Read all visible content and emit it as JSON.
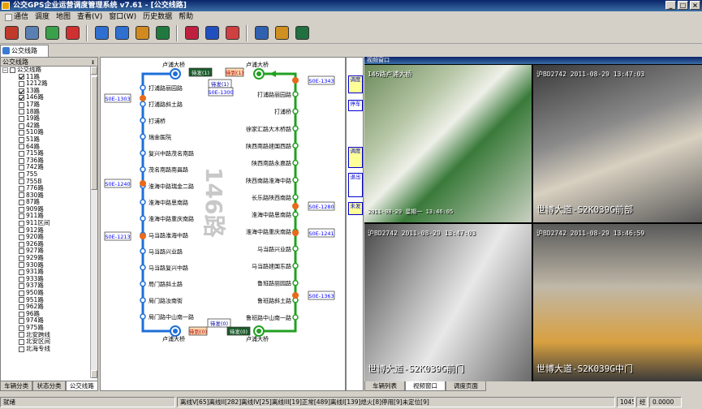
{
  "window": {
    "title": "公交GPS企业运营调度管理系统 v7.61 - [公交线路]"
  },
  "menu": [
    "通信",
    "调度",
    "地图",
    "查看(V)",
    "窗口(W)",
    "历史数据",
    "帮助"
  ],
  "toolbar_icons": [
    "people-icon",
    "document-icon",
    "refresh-icon",
    "delete-icon",
    "zoom-in-icon",
    "zoom-out-icon",
    "globe-icon",
    "grid-icon",
    "book-icon",
    "edit-icon",
    "card-icon",
    "calculator-icon",
    "gift-icon",
    "monitor-icon"
  ],
  "doc_tab": "公交线路",
  "left_panel": {
    "title": "公交线路",
    "root": "公交线路",
    "routes": [
      {
        "name": "11路",
        "checked": true
      },
      {
        "name": "1212路",
        "checked": false
      },
      {
        "name": "13路",
        "checked": true
      },
      {
        "name": "146路",
        "checked": true
      },
      {
        "name": "17路",
        "checked": false
      },
      {
        "name": "18路",
        "checked": false
      },
      {
        "name": "19路",
        "checked": false
      },
      {
        "name": "42路",
        "checked": false
      },
      {
        "name": "510路",
        "checked": false
      },
      {
        "name": "51路",
        "checked": false
      },
      {
        "name": "64路",
        "checked": false
      },
      {
        "name": "715路",
        "checked": false
      },
      {
        "name": "736路",
        "checked": false
      },
      {
        "name": "742路",
        "checked": false
      },
      {
        "name": "755",
        "checked": false
      },
      {
        "name": "755B",
        "checked": false
      },
      {
        "name": "776路",
        "checked": false
      },
      {
        "name": "830路",
        "checked": false
      },
      {
        "name": "87路",
        "checked": false
      },
      {
        "name": "909路",
        "checked": false
      },
      {
        "name": "911路",
        "checked": false
      },
      {
        "name": "911区间",
        "checked": false
      },
      {
        "name": "912路",
        "checked": false
      },
      {
        "name": "920路",
        "checked": false
      },
      {
        "name": "926路",
        "checked": false
      },
      {
        "name": "927路",
        "checked": false
      },
      {
        "name": "929路",
        "checked": false
      },
      {
        "name": "930路",
        "checked": false
      },
      {
        "name": "931路",
        "checked": false
      },
      {
        "name": "933路",
        "checked": false
      },
      {
        "name": "937路",
        "checked": false
      },
      {
        "name": "950路",
        "checked": false
      },
      {
        "name": "951路",
        "checked": false
      },
      {
        "name": "962路",
        "checked": false
      },
      {
        "name": "96路",
        "checked": false
      },
      {
        "name": "974路",
        "checked": false
      },
      {
        "name": "975路",
        "checked": false
      },
      {
        "name": "北安跨线",
        "checked": false
      },
      {
        "name": "北安区间",
        "checked": false
      },
      {
        "name": "北海专线",
        "checked": false
      }
    ],
    "tabs": [
      "车辆分类",
      "状态分类",
      "公交线路"
    ]
  },
  "route_diagram": {
    "route_name": "146路",
    "terminal_top": "卢浦大桥",
    "terminal_bottom": "卢浦大桥",
    "up_stations": [
      "打浦路丽园路",
      "打浦路斜土路",
      "打浦桥",
      "瑞金医院",
      "复兴中路茂名南路",
      "茂名南路南昌路",
      "淮海中路瑞金二路",
      "淮海中路思南路",
      "淮海中路重庆南路",
      "马当路淮海中路",
      "马当路兴业路",
      "马当路复兴中路",
      "局门路斜土路",
      "局门路汝南街",
      "局门路中山南一路"
    ],
    "down_stations": [
      "打浦路丽园路",
      "打浦桥",
      "徐家汇路大木桥路",
      "陕西南路建国西路",
      "陕西南路永嘉路",
      "陕西南路淮海中路",
      "长乐路陕西南路",
      "淮海中路思南路",
      "淮海中路重庆南路",
      "马当路兴业路",
      "马当路建国东路",
      "鲁班路丽园路",
      "鲁班路斜土路",
      "鲁班路中山南一路"
    ],
    "up_labels": {
      "wait": "待发(1)",
      "arrive": "待到(1)",
      "wait2": "待发(1)"
    },
    "down_labels": {
      "wait": "待发(0)",
      "arrive": "待到(0)"
    },
    "bus_tags_left": [
      "S0E-1303",
      "S0E-1240",
      "S0E-1213"
    ],
    "bus_tags_right": [
      "S0E-1343",
      "S0E-1280",
      "S0E-1241",
      "S0E-1363"
    ],
    "top_badge": "S0E-1300",
    "up_color": "#1e6fd9",
    "down_color": "#22a022"
  },
  "side_buttons": [
    "调度",
    "停车",
    "调度",
    "退出",
    "未发"
  ],
  "video": {
    "title": "视频窗口",
    "cameras": [
      {
        "top_text": "146路卢浦大桥",
        "bottom_text": "2011-08-29 星期一 13:46:05"
      },
      {
        "top_text": "沪BD2742      2011-08-29 13:47:03",
        "bottom_text": "世博大道-S2K039G前部"
      },
      {
        "top_text": "沪BD2742      2011-08-29 13:47:03",
        "bottom_text": "世博大道-S2K039G前门"
      },
      {
        "top_text": "沪BD2742      2011-08-29 13:46:59",
        "bottom_text": "世博大道-S2K039G中门"
      }
    ]
  },
  "right_tabs": [
    "车辆列表",
    "视频窗口",
    "调度页面"
  ],
  "status": {
    "left": "就绪",
    "stats": "离线V[65]离线II[282]离线IV[25]离线III[19]正常[489]离线I[139]熄火[8]停用[9]未定位[9]",
    "num": "1045",
    "zoom": "经",
    "value": "0.0000"
  }
}
